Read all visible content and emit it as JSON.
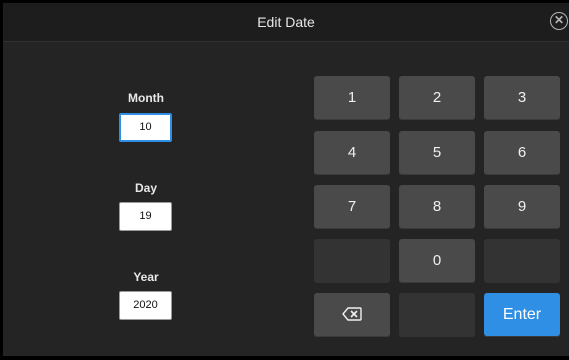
{
  "dialog": {
    "title": "Edit Date",
    "close_icon": "close-circle-icon"
  },
  "fields": {
    "month": {
      "label": "Month",
      "value": "10",
      "focused": true
    },
    "day": {
      "label": "Day",
      "value": "19"
    },
    "year": {
      "label": "Year",
      "value": "2020"
    }
  },
  "keypad": {
    "keys": [
      "1",
      "2",
      "3",
      "4",
      "5",
      "6",
      "7",
      "8",
      "9",
      "0"
    ],
    "backspace_icon": "backspace-icon",
    "enter_label": "Enter"
  },
  "colors": {
    "accent": "#2f8fe4",
    "key": "#4a4a4a",
    "blank_key": "#333333",
    "panel": "#242424"
  }
}
